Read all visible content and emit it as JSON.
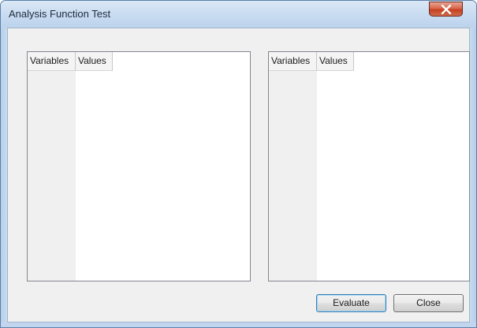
{
  "window": {
    "title": "Analysis Function Test",
    "close_icon": "close-x-icon"
  },
  "left_list": {
    "columns": [
      "Variables",
      "Values"
    ],
    "rows": []
  },
  "right_list": {
    "columns": [
      "Variables",
      "Values"
    ],
    "rows": []
  },
  "buttons": {
    "evaluate_label": "Evaluate",
    "close_label": "Close"
  },
  "colors": {
    "title_bar": "#c9dcf1",
    "close_button": "#d05a3c",
    "dialog_background": "#f0f0f0",
    "default_button_border": "#3c7fb1"
  }
}
